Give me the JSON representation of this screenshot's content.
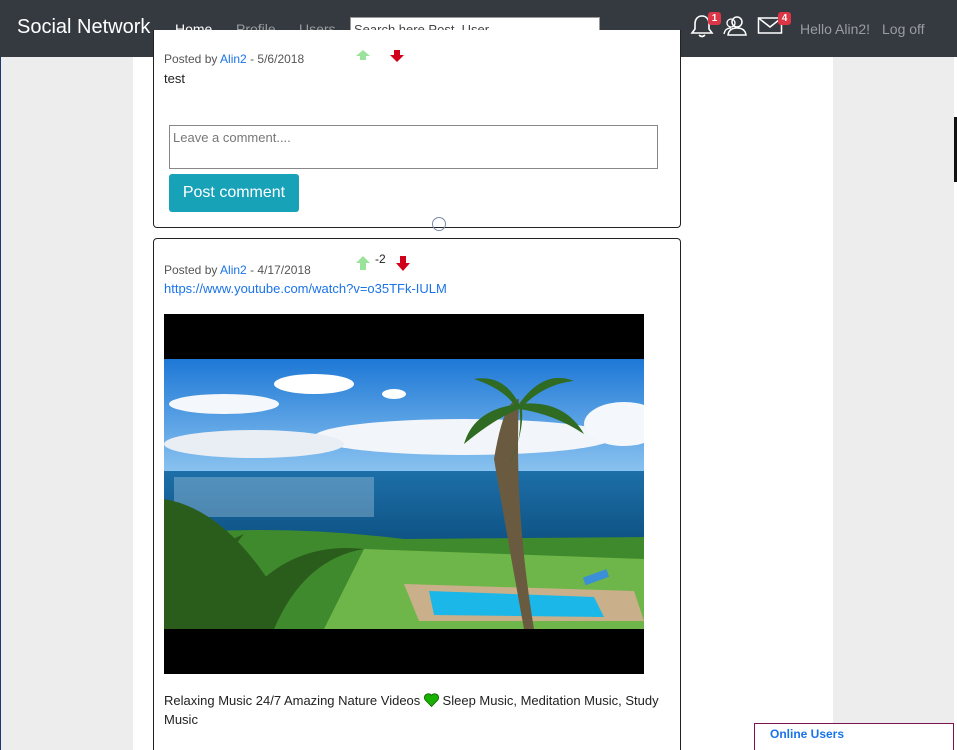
{
  "navbar": {
    "brand": "Social Network",
    "links": [
      {
        "label": "Home",
        "active": true
      },
      {
        "label": "Profile",
        "active": false
      },
      {
        "label": "Users",
        "active": false
      }
    ],
    "search_placeholder": "Search here Post, User",
    "notifications_count": "1",
    "messages_count": "4",
    "greeting": "Hello Alin2!",
    "logoff": "Log off"
  },
  "posts": [
    {
      "posted_by_prefix": "Posted by",
      "author": "Alin2",
      "date_sep": "-",
      "date": "5/6/2018",
      "text": "test",
      "comment_placeholder": "Leave a comment....",
      "post_comment_label": "Post comment"
    },
    {
      "posted_by_prefix": "Posted by",
      "author": "Alin2",
      "date_sep": "-",
      "date": "4/17/2018",
      "score": "-2",
      "link": "https://www.youtube.com/watch?v=o35TFk-IULM",
      "caption_part1": "Relaxing Music 24/7 Amazing Nature Videos",
      "caption_part2": "Sleep Music, Meditation Music, Study Music"
    }
  ],
  "online_users": {
    "label": "Online Users"
  },
  "colors": {
    "navbar": "#343a40",
    "accent_button": "#17a2b8",
    "link": "#1a73e8",
    "badge": "#dc3545",
    "upvote": "#9be29b",
    "downvote": "#d0021b"
  },
  "icons": [
    "bell-icon",
    "users-icon",
    "envelope-icon",
    "upvote-arrow-icon",
    "downvote-arrow-icon",
    "green-heart-icon"
  ]
}
